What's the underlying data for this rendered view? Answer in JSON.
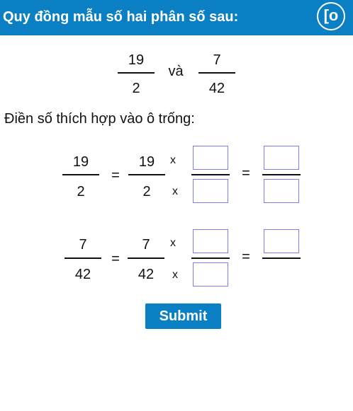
{
  "header": {
    "title": "Quy đồng mẫu số hai phân số sau:",
    "logo_text": "[o",
    "bg_color": "#0b7fc4"
  },
  "problem": {
    "fraction1": {
      "numerator": "19",
      "denominator": "2"
    },
    "conjunction": "và",
    "fraction2": {
      "numerator": "7",
      "denominator": "42"
    }
  },
  "instruction": "Điền số thích hợp vào ô trống:",
  "rows": [
    {
      "fraction": {
        "numerator": "19",
        "denominator": "2"
      },
      "equals": "=",
      "times": "x",
      "inputs": {
        "multiplier_numerator": "",
        "multiplier_denominator": "",
        "result_numerator": "",
        "result_denominator": ""
      }
    },
    {
      "fraction": {
        "numerator": "7",
        "denominator": "42"
      },
      "equals": "=",
      "times": "x",
      "inputs": {
        "multiplier_numerator": "",
        "multiplier_denominator": "",
        "result_numerator": ""
      }
    }
  ],
  "submit_label": "Submit",
  "input_border_color": "#7d7df0"
}
